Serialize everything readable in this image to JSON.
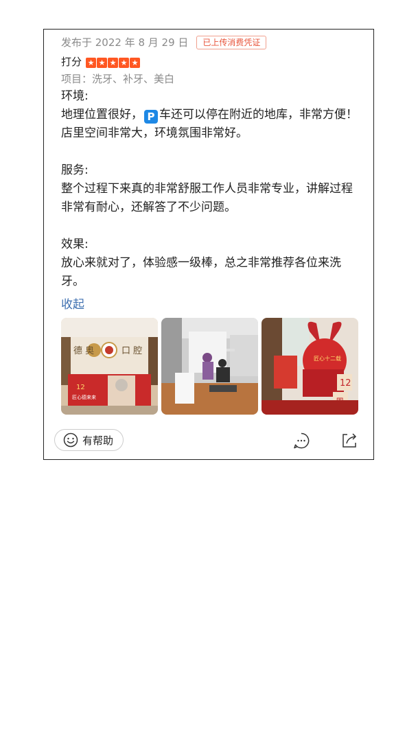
{
  "review": {
    "date": "发布于 2022 年 8 月 29 日",
    "badge": "已上传消费凭证",
    "score_label": "打分",
    "stars": 5,
    "items": "项目：洗牙、补牙、美白",
    "env_title": "环境:",
    "env_text_pre": "地理位置很好，",
    "env_parking_glyph": "P",
    "env_text_post": "车还可以停在附近的地库，非常方便！店里空间非常大，环境氛围非常好。",
    "service_title": "服务:",
    "service_text": "整个过程下来真的非常舒服工作人员非常专业，讲解过程非常有耐心，还解答了不少问题。",
    "effect_title": "效果:",
    "effect_text": "放心来就对了，体验感一级棒，总之非常推荐各位来洗牙。",
    "collapse_label": "收起",
    "photos": [
      {
        "icon": "clinic-reception-photo"
      },
      {
        "icon": "dental-treatment-photo"
      },
      {
        "icon": "anniversary-display-photo"
      }
    ]
  },
  "footer": {
    "helpful_label": "有帮助",
    "icons": [
      "smile-icon",
      "comment-icon",
      "share-icon"
    ]
  },
  "colors": {
    "accent": "#ff5722",
    "badge": "#e8553b",
    "link": "#3d6fb0",
    "muted": "#8a8a8a"
  }
}
